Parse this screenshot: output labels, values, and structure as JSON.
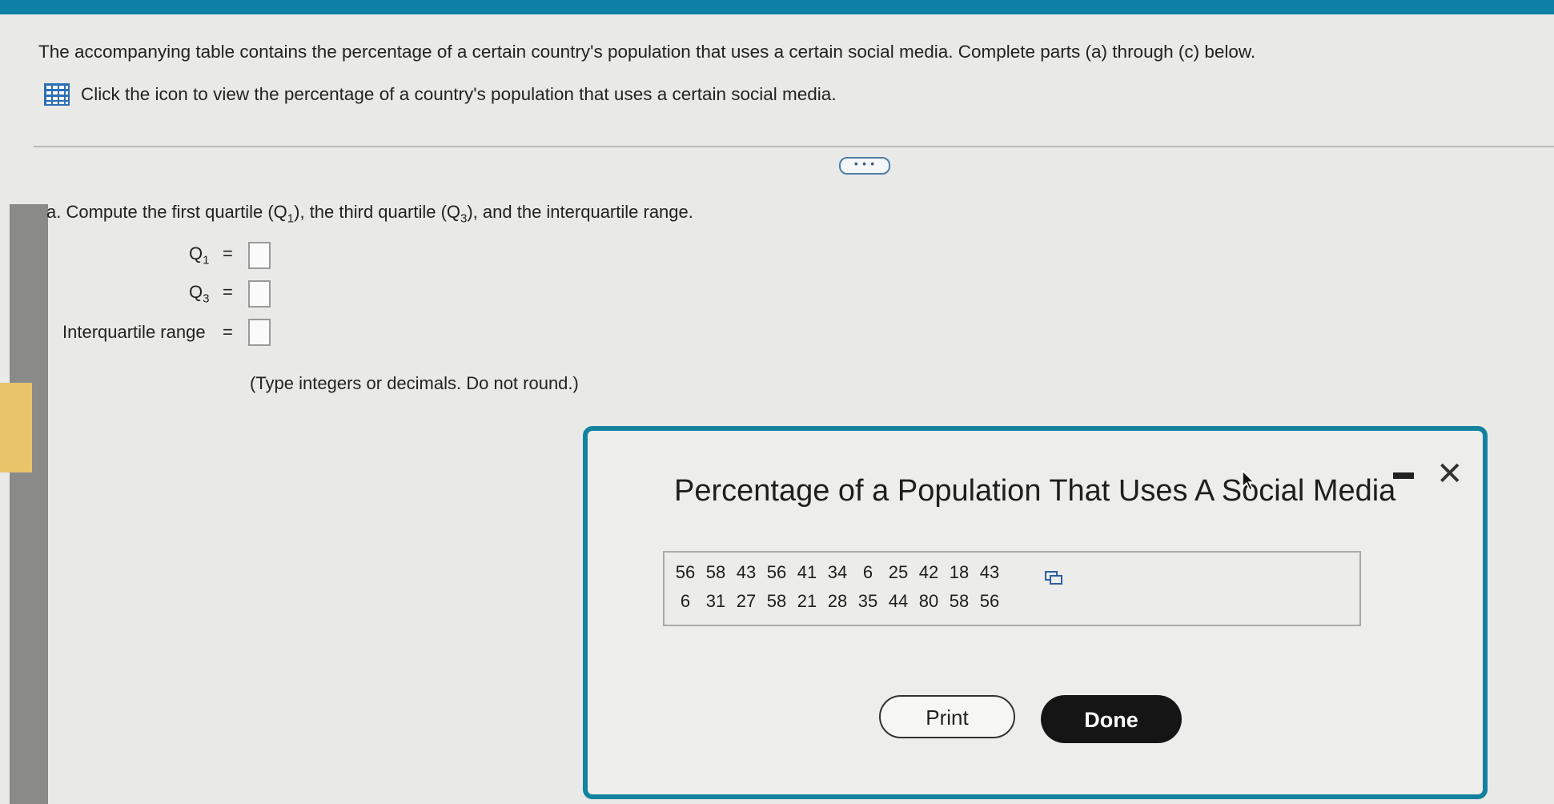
{
  "intro": {
    "text": "The accompanying table contains the percentage of a certain country's population that uses a certain social media. Complete parts (a) through (c) below.",
    "icon_link_text": "Click the icon to view the percentage of a country's population that uses a certain social media."
  },
  "divider": {
    "more_label": "• • •"
  },
  "part_a": {
    "prefix": "a. Compute the first quartile (Q",
    "sub1": "1",
    "mid": "), the third quartile (Q",
    "sub3": "3",
    "suffix": "), and the interquartile range.",
    "q1_label": "Q",
    "q1_sub": "1",
    "q3_label": "Q",
    "q3_sub": "3",
    "iqr_label": "Interquartile range",
    "equals": "=",
    "hint": "(Type integers or decimals. Do not round.)"
  },
  "modal": {
    "title": "Percentage of a Population That Uses A Social Media",
    "close_symbol": "✕",
    "rows": [
      [
        "56",
        "58",
        "43",
        "56",
        "41",
        "34",
        "6",
        "25",
        "42",
        "18",
        "43"
      ],
      [
        "6",
        "31",
        "27",
        "58",
        "21",
        "28",
        "35",
        "44",
        "80",
        "58",
        "56"
      ]
    ],
    "print_label": "Print",
    "done_label": "Done"
  },
  "colors": {
    "topbar": "#0e7fa6",
    "modal_border": "#13829f",
    "done_button": "#151515"
  },
  "icons": [
    "table-grid-icon",
    "copy-icon",
    "minimize-icon",
    "close-icon"
  ]
}
